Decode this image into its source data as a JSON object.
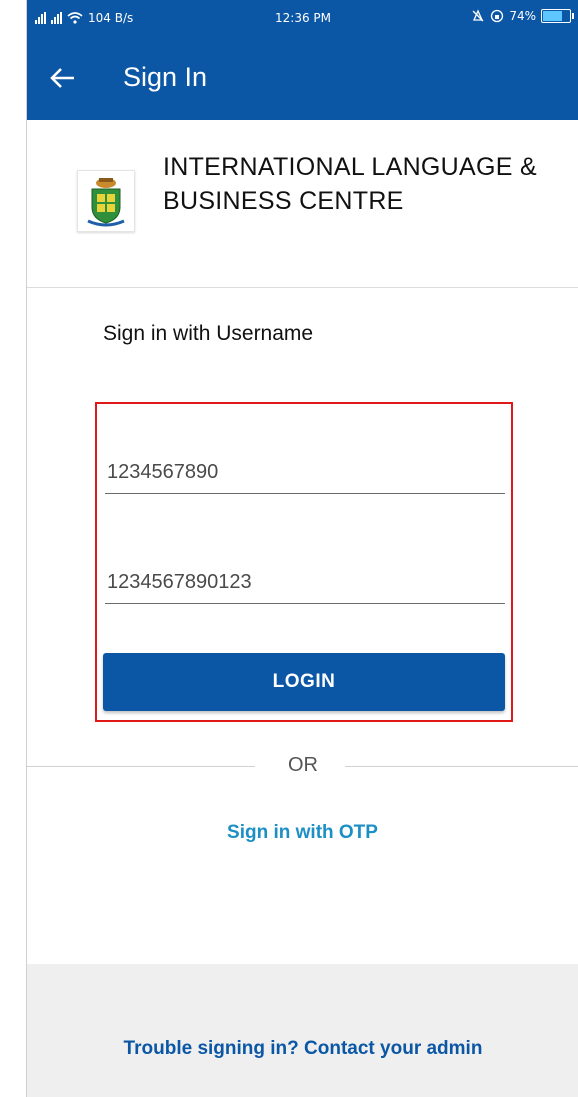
{
  "status_bar": {
    "network_speed": "104 B/s",
    "time": "12:36 PM",
    "battery_percent": "74%",
    "battery_level": 0.74
  },
  "app_bar": {
    "title": "Sign In",
    "back_icon": "arrow-left-icon"
  },
  "org": {
    "name": "INTERNATIONAL LANGUAGE & BUSINESS CENTRE",
    "logo_icon": "org-crest-icon"
  },
  "form": {
    "section_title": "Sign in with Username",
    "username_value": "1234567890",
    "password_value": "1234567890123",
    "login_label": "LOGIN"
  },
  "divider": {
    "or_label": "OR"
  },
  "links": {
    "otp_label": "Sign in with OTP",
    "trouble_label": "Trouble signing in? Contact your admin"
  },
  "colors": {
    "primary": "#0c57a5",
    "link": "#1c8fc5",
    "highlight": "#e01818",
    "footer_bg": "#efefef"
  }
}
